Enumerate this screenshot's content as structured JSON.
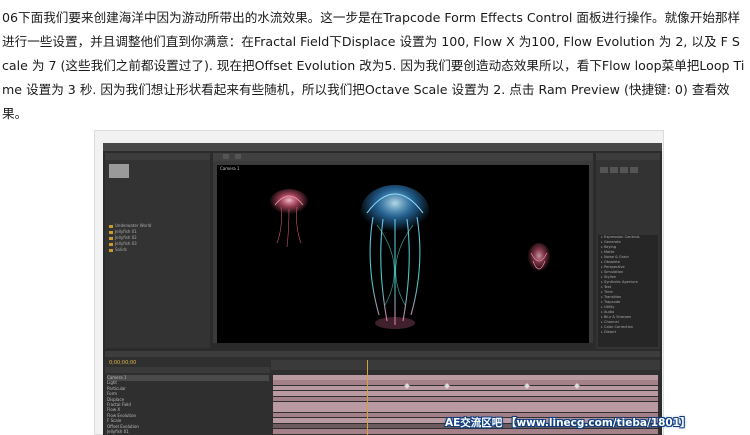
{
  "article": {
    "paragraph": "06下面我们要来创建海洋中因为游动所带出的水流效果。这一步是在Trapcode Form Effects Control 面板进行操作。就像开始那样进行一些设置，并且调整他们直到你满意：在Fractal Field下Displace 设置为 100, Flow X 为100, Flow Evolution 为 2, 以及 F Scale 为 7 (这些我们之前都设置过了). 现在把Offset Evolution 改为5. 因为我们要创造动态效果所以，看下Flow loop菜单把Loop Time 设置为 3 秒. 因为我们想让形状看起来有些随机，所以我们把Octave Scale 设置为 2. 点击 Ram Preview (快捷键: 0) 查看效果。"
  },
  "screenshot": {
    "comp_label": "Camera 1",
    "timecode": "0;00;00;00",
    "project_rows": [
      "Underwater World",
      "Jellyfish 01",
      "Jellyfish 02",
      "Jellyfish 03",
      "Solids"
    ],
    "effect_items": [
      "Expression Controls",
      "Generate",
      "Keying",
      "Matte",
      "Noise & Grain",
      "Obsolete",
      "Perspective",
      "Simulation",
      "Stylize",
      "Synthetic Aperture",
      "Text",
      "Time",
      "Transition",
      "Trapcode",
      "Utility",
      "Audio",
      "Blur & Sharpen",
      "Channel",
      "Color Correction",
      "Distort"
    ],
    "timeline_layers": [
      "Camera 1",
      "Light",
      "Particular",
      "Form",
      "Displace",
      "Fractal Field",
      "Flow X",
      "Flow Evolution",
      "F Scale",
      "Offset Evolution",
      "Jellyfish 01"
    ]
  },
  "watermark": {
    "text": "AE交流区吧 【www.linecg.com/tieba/1801】"
  },
  "colors": {
    "jelly_pink": "#ff6a8c",
    "jelly_blue": "#3fa9ff",
    "jelly_cyan": "#46e0d2",
    "timeline_bar": "#b99aa2",
    "accent": "#d9a13a"
  }
}
